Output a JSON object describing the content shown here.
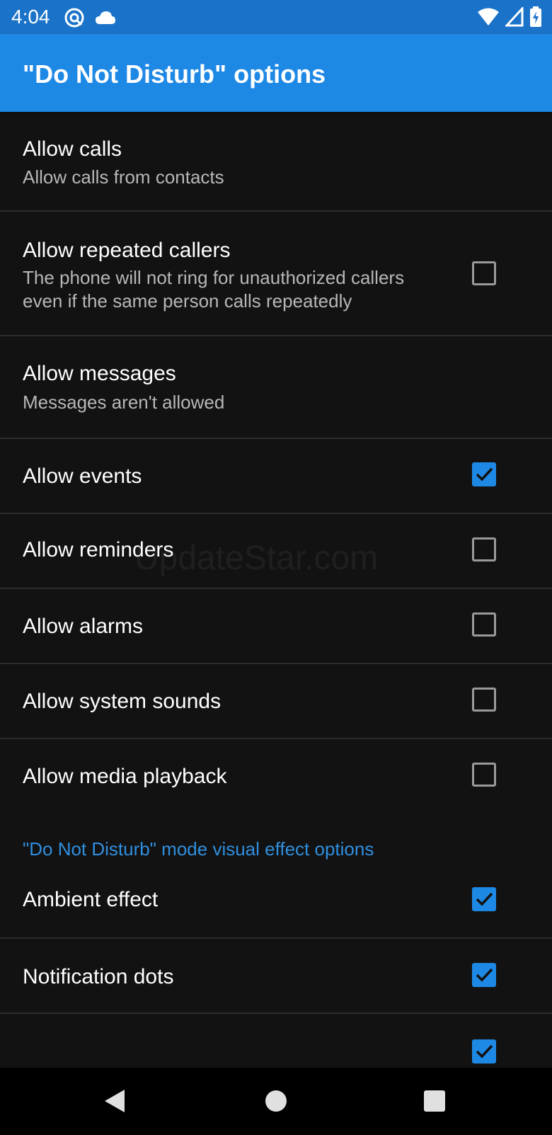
{
  "status_bar": {
    "time": "4:04",
    "left_icons": [
      "vpn-icon",
      "cloud-icon"
    ],
    "right_icons": [
      "wifi-icon",
      "signal-icon",
      "battery-charging-icon"
    ]
  },
  "app_bar": {
    "title": "\"Do Not Disturb\" options"
  },
  "settings": {
    "allow_calls": {
      "title": "Allow calls",
      "subtitle": "Allow calls from contacts"
    },
    "allow_repeated_callers": {
      "title": "Allow repeated callers",
      "subtitle": "The phone will not ring for unauthorized callers even if the same person calls repeatedly",
      "checked": false
    },
    "allow_messages": {
      "title": "Allow messages",
      "subtitle": "Messages aren't allowed"
    },
    "allow_events": {
      "title": "Allow events",
      "checked": true
    },
    "allow_reminders": {
      "title": "Allow reminders",
      "checked": false
    },
    "allow_alarms": {
      "title": "Allow alarms",
      "checked": false
    },
    "allow_system_sounds": {
      "title": "Allow system sounds",
      "checked": false
    },
    "allow_media_playback": {
      "title": "Allow media playback",
      "checked": false
    }
  },
  "visual_section": {
    "header": "\"Do Not Disturb\" mode visual effect options",
    "ambient_effect": {
      "title": "Ambient effect",
      "checked": true
    },
    "notification_dots": {
      "title": "Notification dots",
      "checked": true
    },
    "partial_row": {
      "checked": true
    }
  },
  "watermark": "UpdateStar.com",
  "colors": {
    "accent": "#1e88e5",
    "status_bar": "#1b73c9",
    "background": "#121212",
    "section_header": "#2f8fe0"
  },
  "nav_bar": {
    "icons": [
      "back-icon",
      "home-icon",
      "recents-icon"
    ]
  }
}
